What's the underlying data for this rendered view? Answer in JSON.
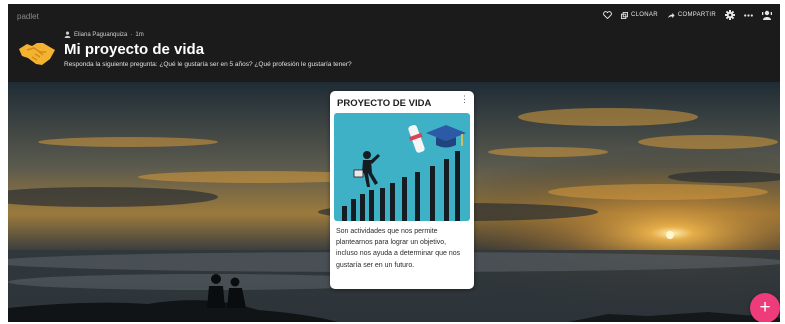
{
  "app": {
    "brand": "padlet"
  },
  "toolbar": {
    "clone_label": "CLONAR",
    "share_label": "COMPARTIR",
    "icons": [
      "heart-icon",
      "clone-icon",
      "share-icon",
      "gear-icon",
      "more-icon",
      "user-icon"
    ]
  },
  "header": {
    "author": "Eliana Paguanquiza",
    "time": "1m",
    "title": "Mi proyecto de vida",
    "description": "Responda la siguiente pregunta: ¿Qué le gustaría ser en 5 años? ¿Qué profesión le gustaría tener?"
  },
  "card": {
    "title": "PROYECTO DE VIDA",
    "menu_icon": "⋮",
    "body": "Son actividades que nos permite plantearnos para lograr un objetivo, incluso nos ayuda a determinar que nos gustaría ser en un futuro."
  },
  "fab": {
    "label": "+"
  },
  "colors": {
    "topbar": "#1b1b1b",
    "fab": "#ee3b7a",
    "card_image_bg": "#3eb1c6",
    "bars": "#151c22"
  }
}
